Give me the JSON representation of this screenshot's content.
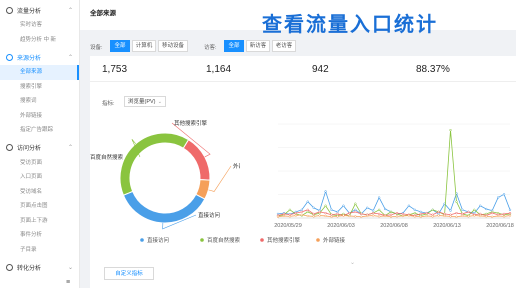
{
  "sidebar": {
    "groups": [
      {
        "label": "流量分析",
        "items": [
          "实时访客",
          "趋势分析 中 新"
        ]
      },
      {
        "label": "来源分析",
        "items": [
          "全部来源",
          "搜索引擎",
          "搜索词",
          "外部链接",
          "指定广告跟踪"
        ]
      },
      {
        "label": "访问分析",
        "items": [
          "受访页面",
          "入口页面",
          "受访域名",
          "页面点击图",
          "页面上下游",
          "事件分析",
          "子目录"
        ]
      },
      {
        "label": "转化分析",
        "items": []
      }
    ],
    "bottom_icon": "≡"
  },
  "header": {
    "page_title": "全部来源",
    "banner_title": "查看流量入口统计"
  },
  "filters": {
    "device_label": "设备:",
    "device_options": [
      "全部",
      "计算机",
      "移动设备"
    ],
    "visitor_label": "访客:",
    "visitor_options": [
      "全部",
      "新访客",
      "老访客"
    ]
  },
  "metrics": [
    "1,753",
    "1,164",
    "942",
    "88.37%"
  ],
  "indicator": {
    "label": "指标:",
    "selected": "浏览量(PV)"
  },
  "donut_labels": [
    "其他搜索引擎",
    "外部链接",
    "直接访问",
    "百度自然搜索"
  ],
  "custom_button": "自定义指标",
  "down_arrow": "⌄",
  "colors": {
    "blue": "#4a9fe8",
    "green": "#8ac43f",
    "red": "#ef6a6a",
    "orange": "#f5a05a",
    "accent": "#1890ff"
  },
  "chart_data": {
    "type": "line",
    "x": [
      "2020/05/29",
      "2020/06/03",
      "2020/06/08",
      "2020/06/13",
      "2020/06/18"
    ],
    "series": [
      {
        "name": "直接访问",
        "color": "#4a9fe8",
        "values": [
          10,
          12,
          9,
          15,
          20,
          40,
          25,
          18,
          65,
          20,
          15,
          30,
          12,
          20,
          10,
          25,
          18,
          50,
          22,
          15,
          10,
          12,
          30,
          20,
          15,
          12,
          20,
          10,
          35,
          18,
          60,
          20,
          15,
          12,
          30,
          22,
          18,
          50,
          58,
          20
        ]
      },
      {
        "name": "百度自然搜索",
        "color": "#8ac43f",
        "values": [
          5,
          8,
          20,
          10,
          6,
          15,
          8,
          12,
          30,
          8,
          6,
          10,
          5,
          35,
          10,
          8,
          12,
          20,
          6,
          15,
          10,
          5,
          8,
          12,
          6,
          10,
          20,
          15,
          8,
          215,
          40,
          10,
          6,
          20,
          8,
          10,
          15,
          12,
          8,
          10
        ]
      },
      {
        "name": "其他搜索引擎",
        "color": "#ef6a6a",
        "values": [
          6,
          10,
          8,
          12,
          15,
          20,
          10,
          15,
          12,
          8,
          10,
          6,
          12,
          15,
          10,
          8,
          12,
          10,
          6,
          8,
          12,
          10,
          8,
          6,
          10,
          12,
          8,
          15,
          10,
          8,
          12,
          10,
          15,
          8,
          10,
          6,
          12,
          8,
          10,
          12
        ]
      },
      {
        "name": "外部链接",
        "color": "#f5a05a",
        "values": [
          3,
          5,
          4,
          6,
          8,
          5,
          4,
          6,
          5,
          3,
          4,
          6,
          5,
          4,
          3,
          5,
          6,
          4,
          5,
          3,
          4,
          5,
          6,
          4,
          3,
          5,
          4,
          6,
          5,
          4,
          3,
          5,
          4,
          6,
          5,
          4,
          3,
          5,
          4,
          6
        ]
      }
    ],
    "ylim": [
      0,
      230
    ],
    "legend": "bottom",
    "donut": {
      "slices": [
        {
          "name": "其他搜索引擎",
          "value": 17,
          "color": "#ef6a6a"
        },
        {
          "name": "外部链接",
          "value": 7,
          "color": "#f5a05a"
        },
        {
          "name": "直接访问",
          "value": 36,
          "color": "#4a9fe8"
        },
        {
          "name": "百度自然搜索",
          "value": 40,
          "color": "#8ac43f"
        }
      ]
    }
  }
}
